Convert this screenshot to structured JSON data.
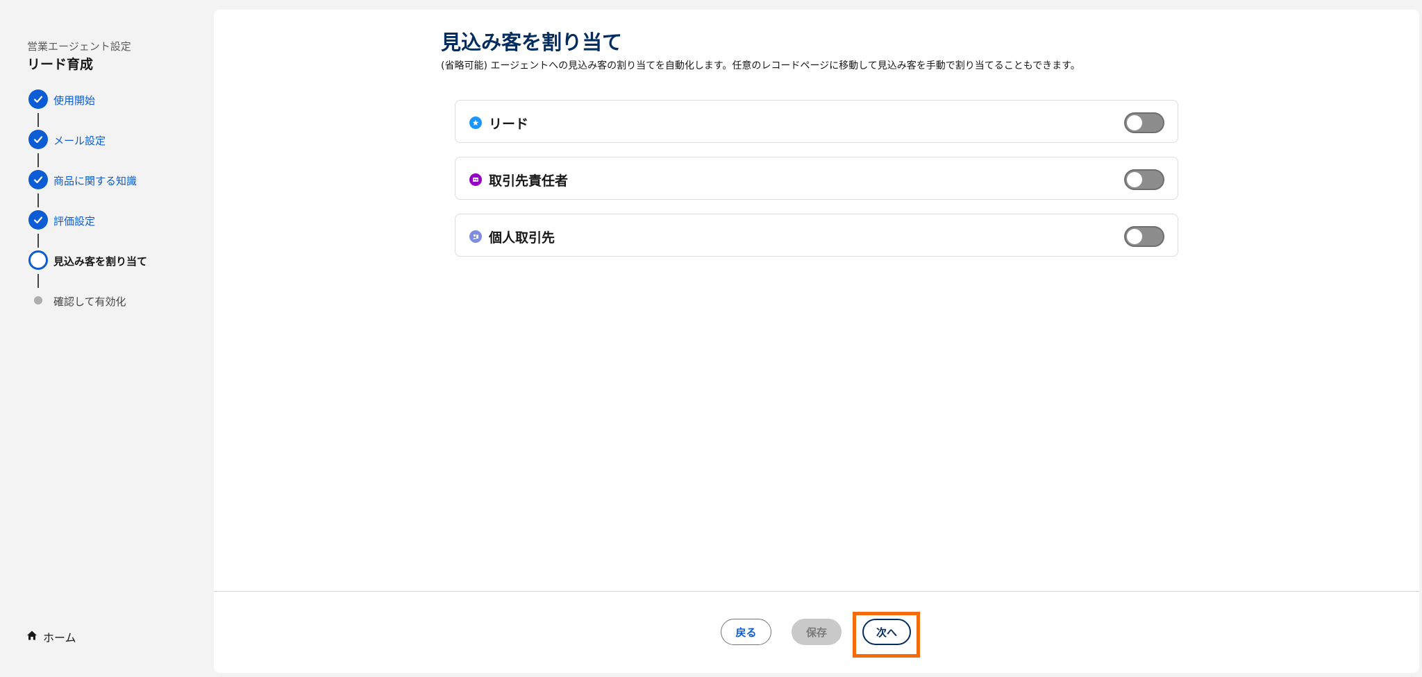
{
  "sidebar": {
    "subtitle": "営業エージェント設定",
    "title": "リード育成",
    "steps": [
      {
        "label": "使用開始",
        "state": "done"
      },
      {
        "label": "メール設定",
        "state": "done"
      },
      {
        "label": "商品に関する知識",
        "state": "done"
      },
      {
        "label": "評価設定",
        "state": "done"
      },
      {
        "label": "見込み客を割り当て",
        "state": "current"
      },
      {
        "label": "確認して有効化",
        "state": "pending"
      }
    ],
    "home_label": "ホーム"
  },
  "main": {
    "title": "見込み客を割り当て",
    "description": "(省略可能) エージェントへの見込み客の割り当てを自動化します。任意のレコードページに移動して見込み客を手動で割り当てることもできます。",
    "cards": [
      {
        "label": "リード",
        "icon": "lead-icon",
        "icon_color": "#1b96ff",
        "toggle_on": false
      },
      {
        "label": "取引先責任者",
        "icon": "contact-icon",
        "icon_color": "#9602c7",
        "toggle_on": false
      },
      {
        "label": "個人取引先",
        "icon": "person-account-icon",
        "icon_color": "#7f8de1",
        "toggle_on": false
      }
    ]
  },
  "footer": {
    "back_label": "戻る",
    "save_label": "保存",
    "next_label": "次へ"
  },
  "colors": {
    "accent": "#0b5cd5",
    "title": "#032d60",
    "highlight": "#f56b0b"
  }
}
